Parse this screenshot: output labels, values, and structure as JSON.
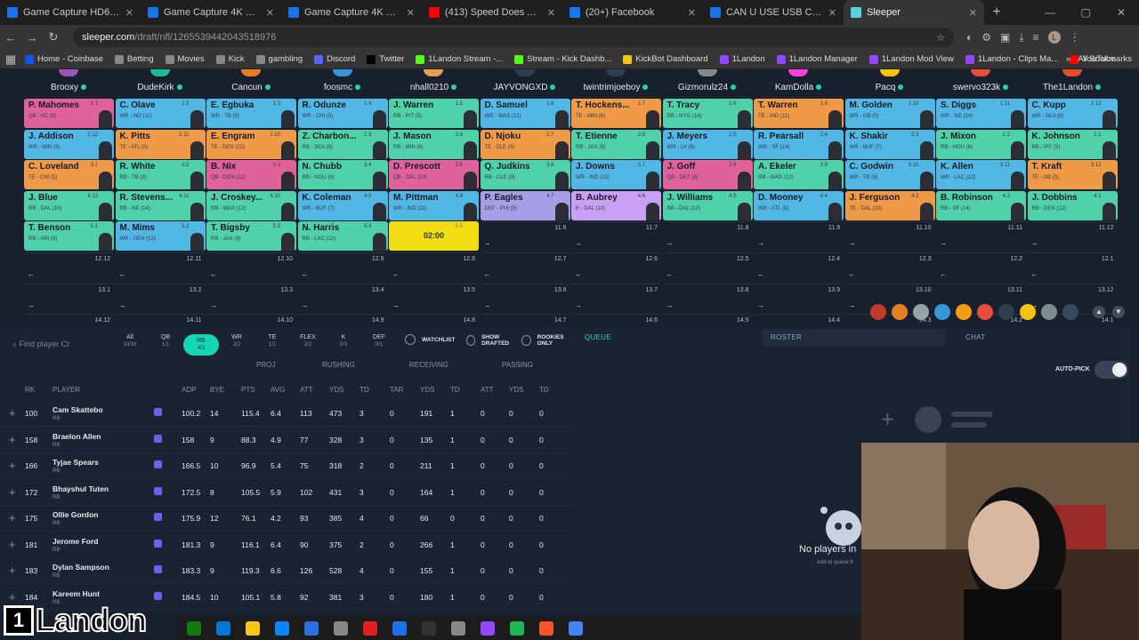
{
  "browser": {
    "tabs": [
      {
        "title": "Game Capture HD60 X | Elgato",
        "color": "#1a73e8",
        "active": false
      },
      {
        "title": "Game Capture 4K S | Capture C",
        "color": "#1a73e8",
        "active": false
      },
      {
        "title": "Game Capture 4K X | Elgato",
        "color": "#1a73e8",
        "active": false
      },
      {
        "title": "(413) Speed Does America us (",
        "color": "#ff0000",
        "active": false
      },
      {
        "title": "(20+) Facebook",
        "color": "#1877f2",
        "active": false
      },
      {
        "title": "CAN U USE USB C TO A ON 4K",
        "color": "#1a73e8",
        "active": false
      },
      {
        "title": "Sleeper",
        "color": "#5ad1e0",
        "active": true
      }
    ],
    "url_site": "sleeper.com",
    "url_path": "/draft/nfl/1265539442043518976",
    "bookmarks": [
      {
        "label": "Home - Coinbase",
        "color": "#1652f0"
      },
      {
        "label": "Betting",
        "color": "#888"
      },
      {
        "label": "Movies",
        "color": "#888"
      },
      {
        "label": "Kick",
        "color": "#888"
      },
      {
        "label": "gambling",
        "color": "#888"
      },
      {
        "label": "Discord",
        "color": "#5865f2"
      },
      {
        "label": "Twitter",
        "color": "#000"
      },
      {
        "label": "1Landon Stream -...",
        "color": "#53fc18"
      },
      {
        "label": "Stream - Kick Dashb...",
        "color": "#53fc18"
      },
      {
        "label": "KickBot Dashboard",
        "color": "#f5c518"
      },
      {
        "label": "1Landon",
        "color": "#9146ff"
      },
      {
        "label": "1Landon Manager",
        "color": "#9146ff"
      },
      {
        "label": "1Landon Mod View",
        "color": "#9146ff"
      },
      {
        "label": "1Landon - Clips Ma...",
        "color": "#9146ff"
      },
      {
        "label": "YouTube",
        "color": "#ff0000"
      }
    ],
    "all_bookmarks": "All Bookmarks"
  },
  "managers": [
    {
      "name": "Brooxy",
      "color": "#9b59b6"
    },
    {
      "name": "DudeKirk",
      "color": "#1abc9c"
    },
    {
      "name": "Cancun",
      "color": "#e67e22"
    },
    {
      "name": "foosmc",
      "color": "#3498db"
    },
    {
      "name": "nhall0210",
      "color": "#e6a04d"
    },
    {
      "name": "JAYVONGXD",
      "color": "#2c3e50"
    },
    {
      "name": "twintrimjoeboy",
      "color": "#2c3e50"
    },
    {
      "name": "Gizmorulz24",
      "color": "#7f8c8d"
    },
    {
      "name": "KamDolla",
      "color": "#ff3fe0"
    },
    {
      "name": "Pacq",
      "color": "#f1c40f"
    },
    {
      "name": "swervo323k",
      "color": "#e74c3c"
    },
    {
      "name": "The1Landon",
      "color": "#e84a2c"
    }
  ],
  "position_colors": {
    "QB": "#e0629a",
    "RB": "#4fd1a9",
    "WR": "#51b7e5",
    "TE": "#ef9a47",
    "DEF": "#a89ee8",
    "K": "#c8a1f5"
  },
  "board": [
    [
      {
        "name": "P. Mahomes",
        "team": "QB - KC (6)",
        "pick": "1.1",
        "pos": "QB"
      },
      {
        "name": "C. Olave",
        "team": "WR - NO (11)",
        "pick": "1.2",
        "pos": "WR"
      },
      {
        "name": "E. Egbuka",
        "team": "WR - TB (9)",
        "pick": "1.3",
        "pos": "WR"
      },
      {
        "name": "R. Odunze",
        "team": "WR - CHI (5)",
        "pick": "1.4",
        "pos": "WR"
      },
      {
        "name": "J. Warren",
        "team": "RB - PIT (5)",
        "pick": "1.5",
        "pos": "RB"
      },
      {
        "name": "D. Samuel",
        "team": "WR - WAS (12)",
        "pick": "1.6",
        "pos": "WR"
      },
      {
        "name": "T. Hockens...",
        "team": "TE - MIN (6)",
        "pick": "1.7",
        "pos": "TE"
      },
      {
        "name": "T. Tracy",
        "team": "RB - NYG (14)",
        "pick": "1.8",
        "pos": "RB"
      },
      {
        "name": "T. Warren",
        "team": "TE - IND (11)",
        "pick": "1.9",
        "pos": "TE"
      },
      {
        "name": "M. Golden",
        "team": "WR - GB (5)",
        "pick": "1.10",
        "pos": "WR"
      },
      {
        "name": "S. Diggs",
        "team": "WR - NE (14)",
        "pick": "1.11",
        "pos": "WR"
      },
      {
        "name": "C. Kupp",
        "team": "WR - SEA (8)",
        "pick": "1.12",
        "pos": "WR"
      }
    ],
    [
      {
        "name": "J. Addison",
        "team": "WR - MIN (6)",
        "pick": "2.12",
        "pos": "WR"
      },
      {
        "name": "K. Pitts",
        "team": "TE - ATL (5)",
        "pick": "2.11",
        "pos": "TE"
      },
      {
        "name": "E. Engram",
        "team": "TE - DEN (12)",
        "pick": "2.10",
        "pos": "TE"
      },
      {
        "name": "Z. Charbon...",
        "team": "RB - SEA (8)",
        "pick": "2.9",
        "pos": "RB"
      },
      {
        "name": "J. Mason",
        "team": "RB - MIN (6)",
        "pick": "2.8",
        "pos": "RB"
      },
      {
        "name": "D. Njoku",
        "team": "TE - CLE (9)",
        "pick": "2.7",
        "pos": "TE"
      },
      {
        "name": "T. Etienne",
        "team": "RB - JAX (8)",
        "pick": "2.6",
        "pos": "RB"
      },
      {
        "name": "J. Meyers",
        "team": "WR - LV (8)",
        "pick": "2.5",
        "pos": "WR"
      },
      {
        "name": "R. Pearsall",
        "team": "WR - SF (14)",
        "pick": "2.4",
        "pos": "WR"
      },
      {
        "name": "K. Shakir",
        "team": "WR - BUF (7)",
        "pick": "2.3",
        "pos": "WR"
      },
      {
        "name": "J. Mixon",
        "team": "RB - HOU (6)",
        "pick": "2.2",
        "pos": "RB"
      },
      {
        "name": "K. Johnson",
        "team": "RB - PIT (5)",
        "pick": "2.1",
        "pos": "RB"
      }
    ],
    [
      {
        "name": "C. Loveland",
        "team": "TE - CHI (5)",
        "pick": "3.1",
        "pos": "TE"
      },
      {
        "name": "R. White",
        "team": "RB - TB (9)",
        "pick": "3.2",
        "pos": "RB"
      },
      {
        "name": "B. Nix",
        "team": "QB - DEN (12)",
        "pick": "3.3",
        "pos": "QB"
      },
      {
        "name": "N. Chubb",
        "team": "RB - HOU (6)",
        "pick": "3.4",
        "pos": "RB"
      },
      {
        "name": "D. Prescott",
        "team": "QB - DAL (10)",
        "pick": "3.5",
        "pos": "QB"
      },
      {
        "name": "Q. Judkins",
        "team": "RB - CLE (9)",
        "pick": "3.6",
        "pos": "RB"
      },
      {
        "name": "J. Downs",
        "team": "WR - IND (11)",
        "pick": "3.7",
        "pos": "WR"
      },
      {
        "name": "J. Goff",
        "team": "QB - DET (8)",
        "pick": "3.8",
        "pos": "QB"
      },
      {
        "name": "A. Ekeler",
        "team": "RB - WAS (12)",
        "pick": "3.9",
        "pos": "RB"
      },
      {
        "name": "C. Godwin",
        "team": "WR - TB (9)",
        "pick": "3.10",
        "pos": "WR"
      },
      {
        "name": "K. Allen",
        "team": "WR - LAC (12)",
        "pick": "3.11",
        "pos": "WR"
      },
      {
        "name": "T. Kraft",
        "team": "TE - GB (5)",
        "pick": "3.12",
        "pos": "TE"
      }
    ],
    [
      {
        "name": "J. Blue",
        "team": "RB - DAL (10)",
        "pick": "4.12",
        "pos": "RB"
      },
      {
        "name": "R. Stevens...",
        "team": "RB - NE (14)",
        "pick": "4.11",
        "pos": "RB"
      },
      {
        "name": "J. Croskey...",
        "team": "RB - WAS (12)",
        "pick": "4.10",
        "pos": "RB"
      },
      {
        "name": "K. Coleman",
        "team": "WR - BUF (7)",
        "pick": "4.9",
        "pos": "WR"
      },
      {
        "name": "M. Pittman",
        "team": "WR - IND (11)",
        "pick": "4.8",
        "pos": "WR"
      },
      {
        "name": "P. Eagles",
        "team": "DEF - PHI (9)",
        "pick": "4.7",
        "pos": "DEF"
      },
      {
        "name": "B. Aubrey",
        "team": "K - DAL (10)",
        "pick": "4.6",
        "pos": "K"
      },
      {
        "name": "J. Williams",
        "team": "RB - DAL (10)",
        "pick": "4.5",
        "pos": "RB"
      },
      {
        "name": "D. Mooney",
        "team": "WR - ATL (5)",
        "pick": "4.4",
        "pos": "WR"
      },
      {
        "name": "J. Ferguson",
        "team": "TE - DAL (10)",
        "pick": "4.3",
        "pos": "TE"
      },
      {
        "name": "B. Robinson",
        "team": "RB - SF (14)",
        "pick": "4.2",
        "pos": "RB"
      },
      {
        "name": "J. Dobbins",
        "team": "RB - DEN (12)",
        "pick": "4.1",
        "pos": "RB"
      }
    ],
    [
      {
        "name": "T. Benson",
        "team": "RB - ARI (8)",
        "pick": "5.1",
        "pos": "RB"
      },
      {
        "name": "M. Mims",
        "team": "WR - DEN (12)",
        "pick": "5.2",
        "pos": "WR"
      },
      {
        "name": "T. Bigsby",
        "team": "RB - JAX (8)",
        "pick": "5.3",
        "pos": "RB"
      },
      {
        "name": "N. Harris",
        "team": "RB - LAC (12)",
        "pick": "5.4",
        "pos": "RB"
      },
      {
        "name": "",
        "team": "",
        "pick": "5.5",
        "timer": "02:00"
      },
      {
        "name": "",
        "team": "",
        "pick": "11.6"
      },
      {
        "name": "",
        "team": "",
        "pick": "11.7"
      },
      {
        "name": "",
        "team": "",
        "pick": "11.8"
      },
      {
        "name": "",
        "team": "",
        "pick": "11.9"
      },
      {
        "name": "",
        "team": "",
        "pick": "11.10"
      },
      {
        "name": "",
        "team": "",
        "pick": "11.11"
      },
      {
        "name": "",
        "team": "",
        "pick": "11.12"
      }
    ],
    [
      {
        "pick": "12.12"
      },
      {
        "pick": "12.11"
      },
      {
        "pick": "12.10"
      },
      {
        "pick": "12.9"
      },
      {
        "pick": "12.8"
      },
      {
        "pick": "12.7"
      },
      {
        "pick": "12.6"
      },
      {
        "pick": "12.5"
      },
      {
        "pick": "12.4"
      },
      {
        "pick": "12.3"
      },
      {
        "pick": "12.2"
      },
      {
        "pick": "12.1"
      }
    ],
    [
      {
        "pick": "13.1"
      },
      {
        "pick": "13.2"
      },
      {
        "pick": "13.3"
      },
      {
        "pick": "13.4"
      },
      {
        "pick": "13.5"
      },
      {
        "pick": "13.6"
      },
      {
        "pick": "13.7"
      },
      {
        "pick": "13.8"
      },
      {
        "pick": "13.9"
      },
      {
        "pick": "13.10"
      },
      {
        "pick": "13.11"
      },
      {
        "pick": "13.12"
      }
    ],
    [
      {
        "pick": "14.12"
      },
      {
        "pick": "14.11"
      },
      {
        "pick": "14.10"
      },
      {
        "pick": "14.9"
      },
      {
        "pick": "14.8"
      },
      {
        "pick": "14.7"
      },
      {
        "pick": "14.6"
      },
      {
        "pick": "14.5"
      },
      {
        "pick": "14.4"
      },
      {
        "pick": "14.3"
      },
      {
        "pick": "14.2"
      },
      {
        "pick": "14.1"
      }
    ]
  ],
  "emoji_colors": [
    "#c0392b",
    "#e67e22",
    "#95a5a6",
    "#3498db",
    "#f39c12",
    "#e74c3c",
    "#2c3e50",
    "#f1c40f",
    "#7f8c8d",
    "#34495e"
  ],
  "players_panel": {
    "search_placeholder": "Find player Ct",
    "filters": [
      {
        "label": "All",
        "count": "10/16",
        "selected": false
      },
      {
        "label": "QB",
        "count": "1/1",
        "selected": false
      },
      {
        "label": "RB",
        "count": "4/2",
        "selected": true
      },
      {
        "label": "WR",
        "count": "2/2",
        "selected": false
      },
      {
        "label": "TE",
        "count": "1/1",
        "selected": false
      },
      {
        "label": "FLEX",
        "count": "2/2",
        "selected": false
      },
      {
        "label": "K",
        "count": "0/3",
        "selected": false
      },
      {
        "label": "DEF",
        "count": "0/1",
        "selected": false
      }
    ],
    "watchlist": "WATCHLIST",
    "show_drafted": "SHOW DRAFTED",
    "rookies_only": "ROOKIES ONLY",
    "groups": {
      "proj": "PROJ",
      "rushing": "RUSHING",
      "receiving": "RECEIVING",
      "passing": "PASSING"
    },
    "columns": [
      "RK",
      "PLAYER",
      "ADP",
      "BYE",
      "PTS",
      "AVG",
      "ATT",
      "YDS",
      "TD",
      "TAR",
      "YDS",
      "TD",
      "ATT",
      "YDS",
      "TD"
    ],
    "rows": [
      {
        "rk": "100",
        "name": "Cam Skattebo",
        "pos": "RB",
        "adp": "100.2",
        "bye": "14",
        "pts": "115.4",
        "avg": "6.4",
        "ratt": "113",
        "ryds": "473",
        "rtd": "3",
        "tar": "0",
        "recyds": "191",
        "rectd": "1",
        "patt": "0",
        "pyds": "0",
        "ptd": "0"
      },
      {
        "rk": "158",
        "name": "Braelon Allen",
        "pos": "RB",
        "adp": "158",
        "bye": "9",
        "pts": "88.3",
        "avg": "4.9",
        "ratt": "77",
        "ryds": "328",
        "rtd": "3",
        "tar": "0",
        "recyds": "135",
        "rectd": "1",
        "patt": "0",
        "pyds": "0",
        "ptd": "0"
      },
      {
        "rk": "166",
        "name": "Tyjae Spears",
        "pos": "RB",
        "adp": "166.5",
        "bye": "10",
        "pts": "96.9",
        "avg": "5.4",
        "ratt": "75",
        "ryds": "318",
        "rtd": "2",
        "tar": "0",
        "recyds": "211",
        "rectd": "1",
        "patt": "0",
        "pyds": "0",
        "ptd": "0"
      },
      {
        "rk": "172",
        "name": "Bhayshul Tuten",
        "pos": "RB",
        "adp": "172.5",
        "bye": "8",
        "pts": "105.5",
        "avg": "5.9",
        "ratt": "102",
        "ryds": "431",
        "rtd": "3",
        "tar": "0",
        "recyds": "164",
        "rectd": "1",
        "patt": "0",
        "pyds": "0",
        "ptd": "0"
      },
      {
        "rk": "175",
        "name": "Ollie Gordon",
        "pos": "RB",
        "adp": "175.9",
        "bye": "12",
        "pts": "76.1",
        "avg": "4.2",
        "ratt": "93",
        "ryds": "385",
        "rtd": "4",
        "tar": "0",
        "recyds": "66",
        "rectd": "0",
        "patt": "0",
        "pyds": "0",
        "ptd": "0"
      },
      {
        "rk": "181",
        "name": "Jerome Ford",
        "pos": "RB",
        "adp": "181.3",
        "bye": "9",
        "pts": "116.1",
        "avg": "6.4",
        "ratt": "90",
        "ryds": "375",
        "rtd": "2",
        "tar": "0",
        "recyds": "266",
        "rectd": "1",
        "patt": "0",
        "pyds": "0",
        "ptd": "0"
      },
      {
        "rk": "183",
        "name": "Dylan Sampson",
        "pos": "RB",
        "adp": "183.3",
        "bye": "9",
        "pts": "119.3",
        "avg": "6.6",
        "ratt": "126",
        "ryds": "528",
        "rtd": "4",
        "tar": "0",
        "recyds": "155",
        "rectd": "1",
        "patt": "0",
        "pyds": "0",
        "ptd": "0"
      },
      {
        "rk": "184",
        "name": "Kareem Hunt",
        "pos": "RB",
        "adp": "184.5",
        "bye": "10",
        "pts": "105.1",
        "avg": "5.8",
        "ratt": "92",
        "ryds": "381",
        "rtd": "3",
        "tar": "0",
        "recyds": "180",
        "rectd": "1",
        "patt": "0",
        "pyds": "0",
        "ptd": "0"
      }
    ]
  },
  "queue": {
    "label": "QUEUE"
  },
  "roster_panel": {
    "roster_tab": "ROSTER",
    "chat_tab": "CHAT",
    "autopick": "AUTO-PICK",
    "empty": "No players in",
    "add_hint": "Add to queue fr"
  },
  "stream": {
    "logo_badge": "1",
    "logo_text": "Landon"
  },
  "taskbar_colors": [
    "#107c10",
    "#0078d4",
    "#f5c518",
    "#0a84ff",
    "#2d6ee0",
    "#888",
    "#e02020",
    "#1a73e8",
    "#333",
    "#888",
    "#9146ff",
    "#1db954",
    "#fb542b",
    "#4285f4"
  ]
}
